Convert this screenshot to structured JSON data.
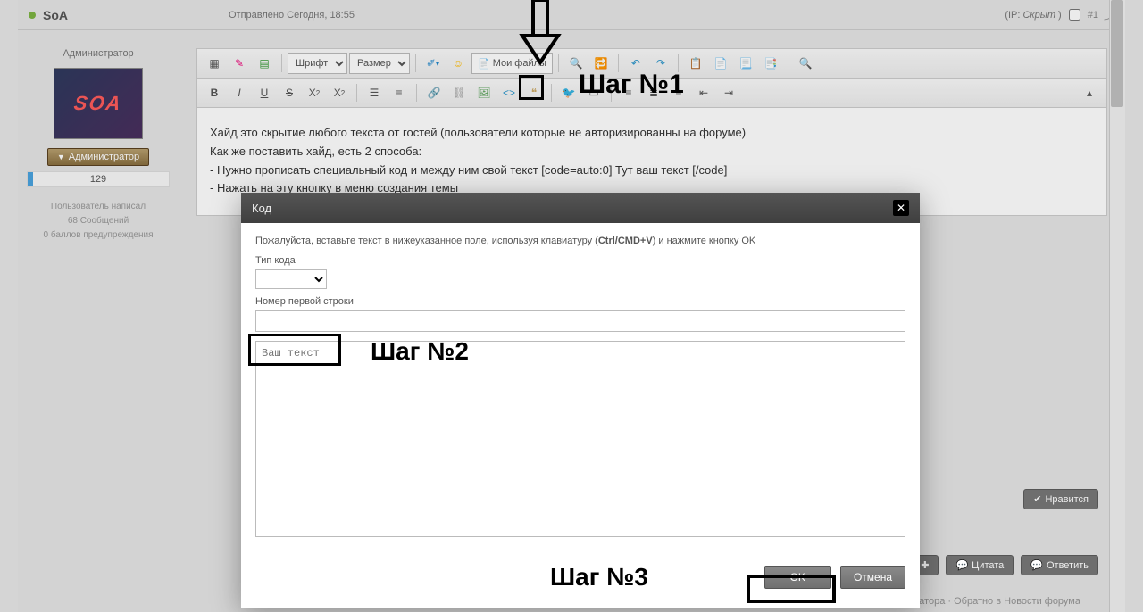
{
  "header": {
    "username": "SoA",
    "sent_prefix": "Отправлено ",
    "sent_when": "Сегодня, 18:55",
    "ip_label": "(IP: ",
    "ip_value": "Скрыт",
    "ip_close": " )",
    "post_number": "#1"
  },
  "sidebar": {
    "role": "Администратор",
    "avatar_text": "SOA",
    "badge": "Администратор",
    "reputation": "129",
    "stats_line1": "Пользователь написал",
    "stats_line2": "68 Сообщений",
    "stats_line3": "0 баллов предупреждения"
  },
  "toolbar": {
    "font_label": "Шрифт",
    "size_label": "Размер",
    "myfiles": "Мои файлы"
  },
  "editor_content": {
    "l1": "Хайд это скрытие любого текста от гостей (пользователи которые не авторизированны на форуме)",
    "l2": "Как же поставить хайд, есть 2 способа:",
    "l3": " - Нужно прописать специальный код и между ним свой текст [code=auto:0] Тут ваш текст [/code]",
    "l4": " - Нажать на эту кнопку в меню создания темы"
  },
  "modal": {
    "title": "Код",
    "instruction_pre": "Пожалуйста, вставьте текст в нижеуказанное поле, используя клавиатуру (",
    "instruction_kbd": "Ctrl/CMD+V",
    "instruction_post": ") и нажмите кнопку OK",
    "code_type_label": "Тип кода",
    "first_line_label": "Номер первой строки",
    "textarea_placeholder": "Ваш текст",
    "ok": "OK",
    "cancel": "Отмена"
  },
  "annotations": {
    "step1": "Шаг №1",
    "step2": "Шаг №2",
    "step3": "Шаг №3"
  },
  "actions": {
    "like": "Нравится",
    "quote": "Цитата",
    "reply": "Ответить"
  },
  "footer": {
    "links": "Опции модератора · Обратно в Новости форума"
  }
}
